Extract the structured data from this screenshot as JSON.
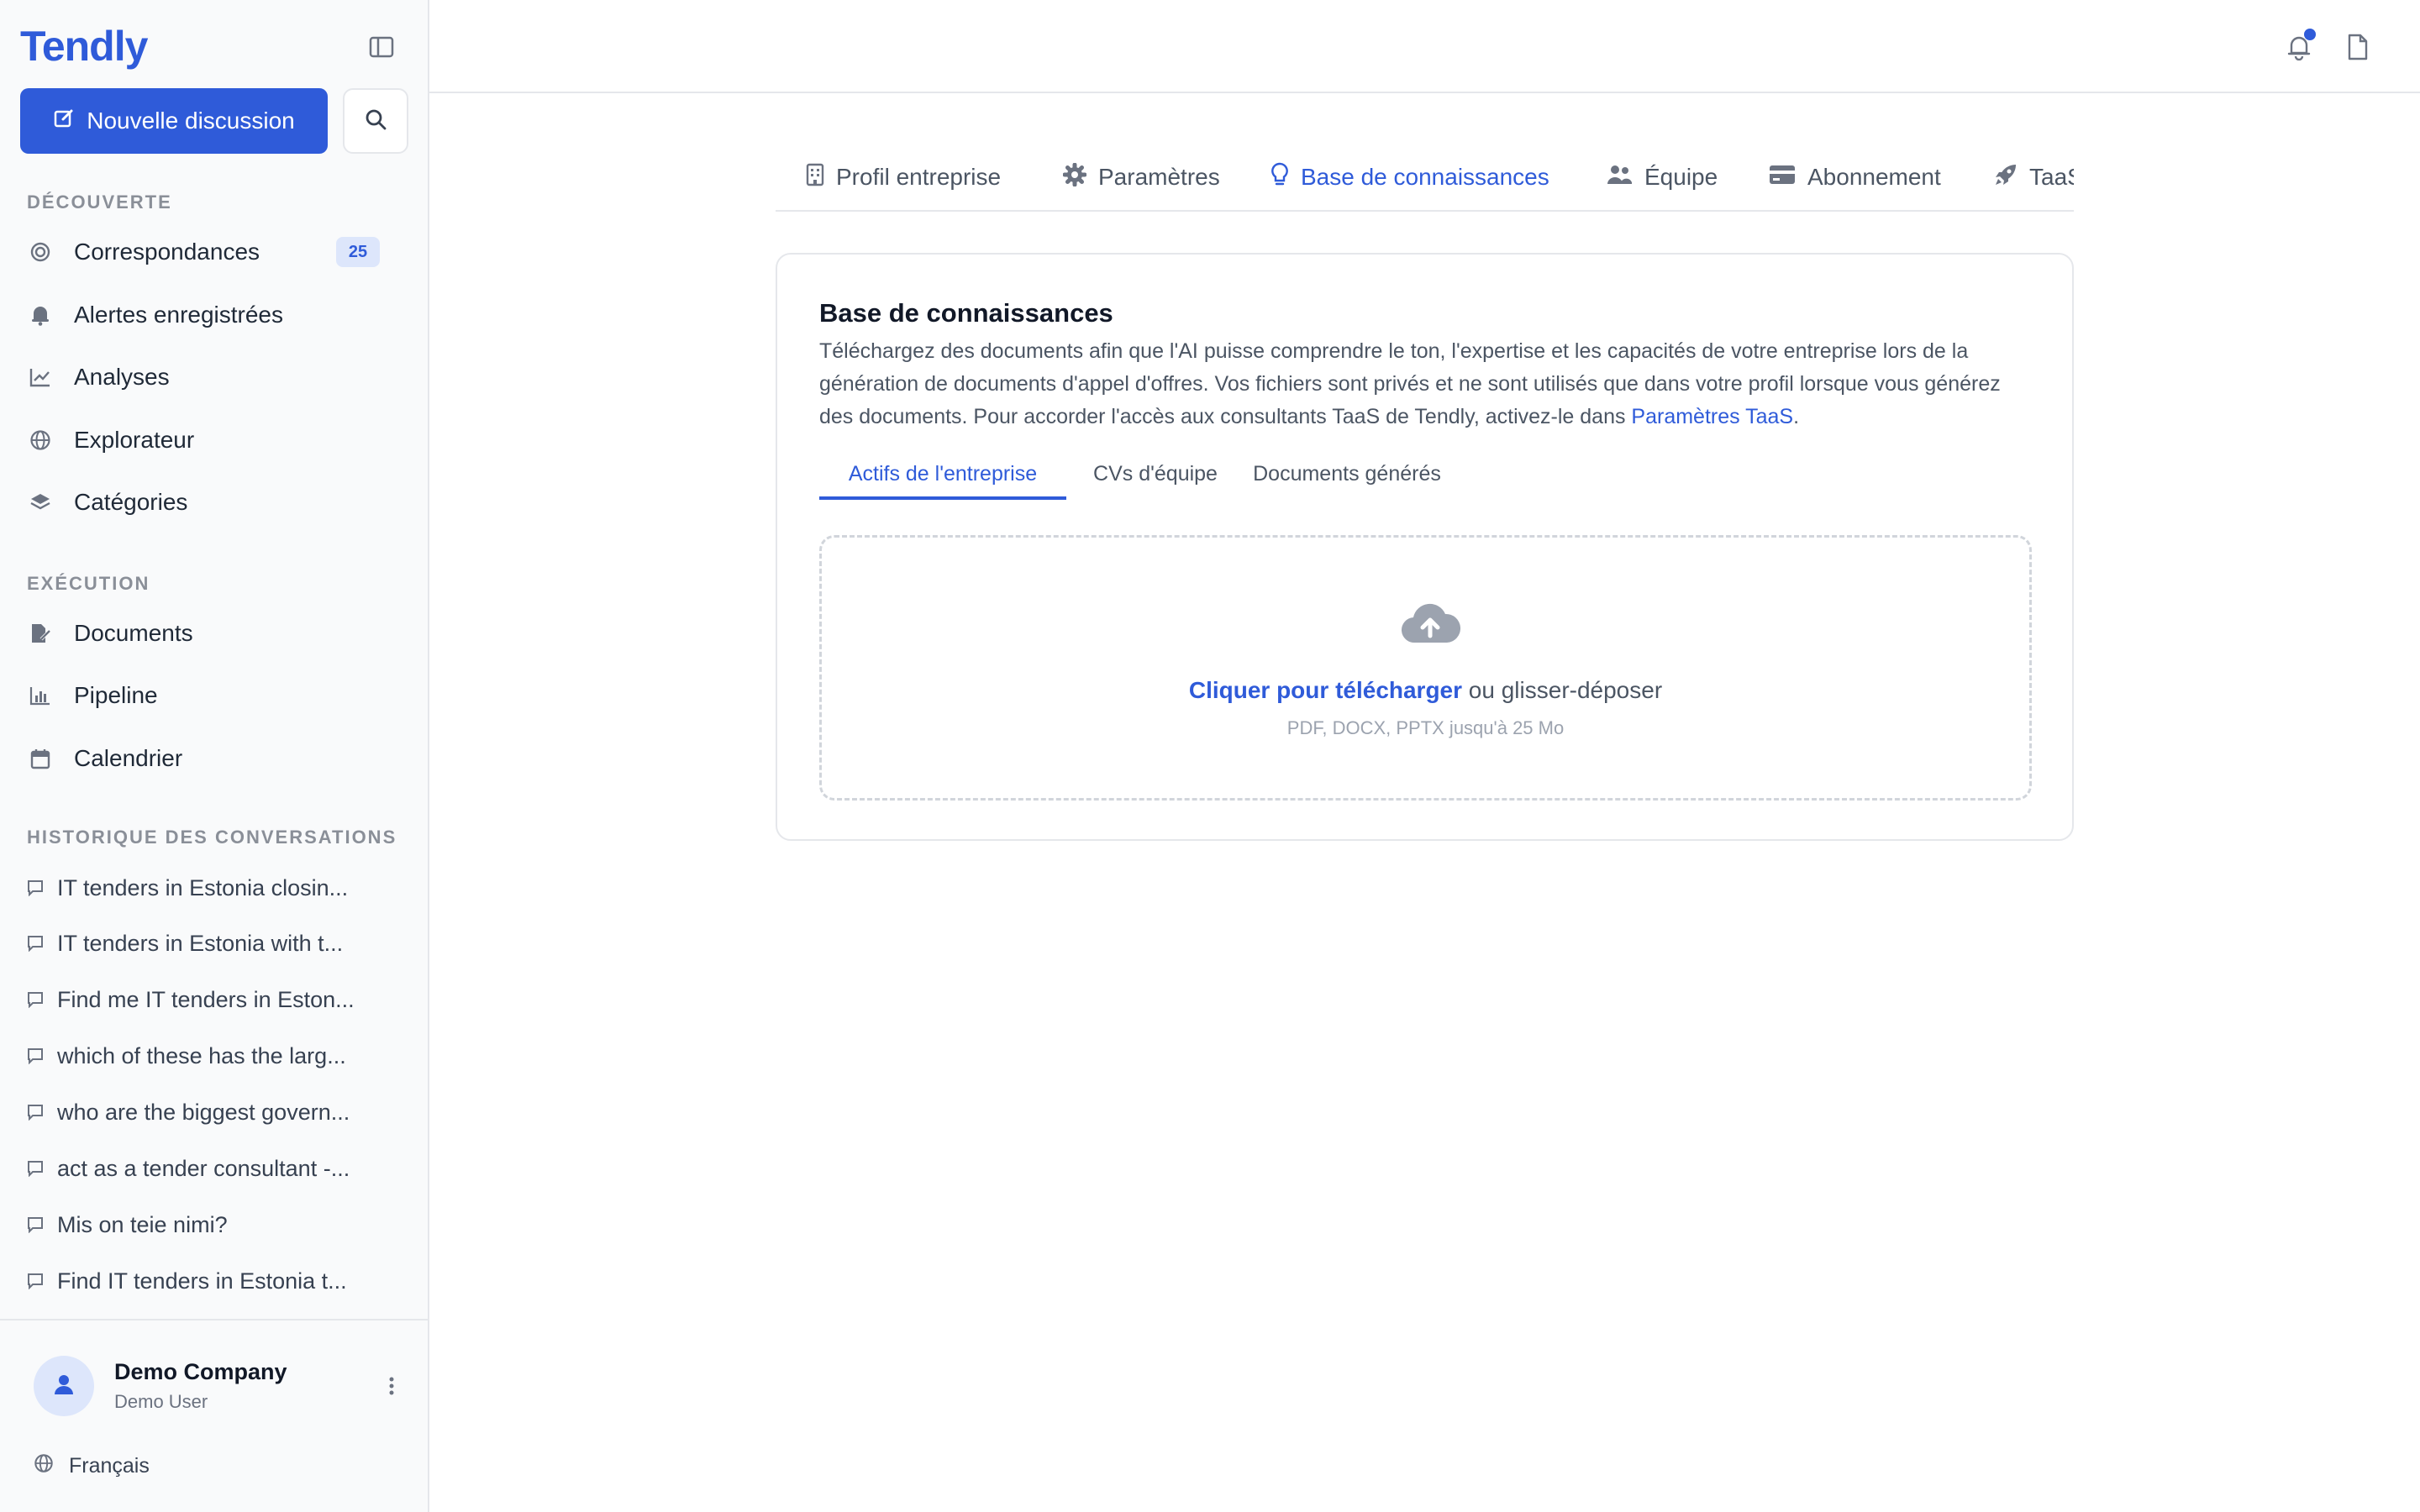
{
  "app": {
    "logo": "Tendly"
  },
  "sidebar": {
    "new_chat_label": "Nouvelle discussion",
    "discovery": {
      "title": "DÉCOUVERTE",
      "items": [
        {
          "label": "Correspondances",
          "icon": "target-icon",
          "badge": "25"
        },
        {
          "label": "Alertes enregistrées",
          "icon": "bell-icon"
        },
        {
          "label": "Analyses",
          "icon": "chart-line-icon"
        },
        {
          "label": "Explorateur",
          "icon": "globe-icon"
        },
        {
          "label": "Catégories",
          "icon": "layers-icon"
        }
      ]
    },
    "execution": {
      "title": "EXÉCUTION",
      "items": [
        {
          "label": "Documents",
          "icon": "file-edit-icon"
        },
        {
          "label": "Pipeline",
          "icon": "bar-chart-icon"
        },
        {
          "label": "Calendrier",
          "icon": "calendar-icon"
        }
      ]
    },
    "history": {
      "title": "HISTORIQUE DES CONVERSATIONS",
      "items": [
        "IT tenders in Estonia closin...",
        "IT tenders in Estonia with t...",
        "Find me IT tenders in Eston...",
        "which of these has the larg...",
        "who are the biggest govern...",
        "act as a tender consultant -...",
        "Mis on teie nimi?",
        "Find IT tenders in Estonia t..."
      ]
    },
    "user": {
      "name": "Demo Company",
      "role": "Demo User"
    },
    "language": "Français"
  },
  "tabs": [
    {
      "label": "Profil entreprise",
      "icon": "building-icon"
    },
    {
      "label": "Paramètres",
      "icon": "gear-icon"
    },
    {
      "label": "Base de connaissances",
      "icon": "lightbulb-icon",
      "active": true
    },
    {
      "label": "Équipe",
      "icon": "users-icon"
    },
    {
      "label": "Abonnement",
      "icon": "credit-card-icon"
    },
    {
      "label": "TaaS",
      "icon": "rocket-icon"
    }
  ],
  "knowledge": {
    "title": "Base de connaissances",
    "description": "Téléchargez des documents afin que l'AI puisse comprendre le ton, l'expertise et les capacités de votre entreprise lors de la génération de documents d'appel d'offres. Vos fichiers sont privés et ne sont utilisés que dans votre profil lorsque vous générez des documents. Pour accorder l'accès aux consultants TaaS de Tendly, activez-le dans ",
    "description_link": "Paramètres TaaS",
    "description_end": ".",
    "subtabs": [
      "Actifs de l'entreprise",
      "CVs d'équipe",
      "Documents générés"
    ],
    "upload": {
      "cta": "Cliquer pour télécharger",
      "rest": " ou glisser-déposer",
      "hint": "PDF, DOCX, PPTX jusqu'à 25 Mo"
    }
  },
  "colors": {
    "accent": "#2f5bd9",
    "sidebar_bg": "#f9fafb",
    "border": "#e5e7eb"
  }
}
